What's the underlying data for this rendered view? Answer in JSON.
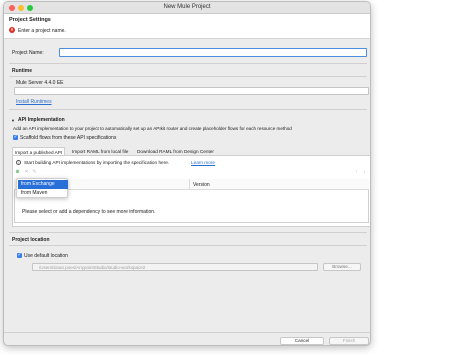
{
  "window": {
    "title": "New Mule Project"
  },
  "header": {
    "title": "Project Settings",
    "error_message": "Enter a project name."
  },
  "project_name": {
    "label": "Project Name:",
    "value": ""
  },
  "runtime": {
    "heading": "Runtime",
    "selected": "Mule Server 4.4.0 EE",
    "install_link": "Install Runtimes"
  },
  "api": {
    "heading": "API Implementation",
    "description": "Add an API implementation to your project to automatically set up an APIkit router and create placeholder flows for each resource method",
    "scaffold_label": "Scaffold flows from these API specifications",
    "tabs": [
      "Import a published API",
      "Import RAML from local file",
      "Download RAML from Design Center"
    ],
    "info_text": "Start building API implementations by importing the specification here.",
    "learn_more": "Learn more",
    "table_header_version": "Version",
    "empty_message": "Please select or add a dependency to see more information.",
    "add_menu": [
      "from Exchange",
      "from Maven"
    ]
  },
  "location": {
    "heading": "Project location",
    "use_default_label": "Use default location",
    "path": "/Users/sinan.poes/AnypointStudio/studio-workspace2",
    "browse_label": "Browse..."
  },
  "footer": {
    "cancel_label": "Cancel",
    "finish_label": "Finish"
  },
  "colors": {
    "accent": "#2a6fd8",
    "error": "#d9322b",
    "link": "#2a6fcf"
  }
}
